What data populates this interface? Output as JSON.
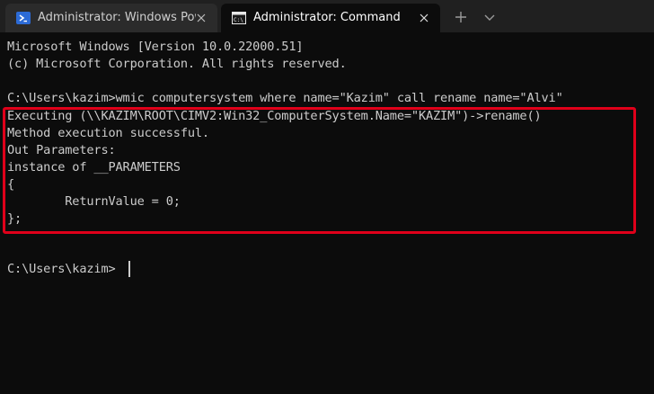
{
  "tabs": [
    {
      "label": "Administrator: Windows PowerShell",
      "icon": "powershell-icon",
      "active": false
    },
    {
      "label": "Administrator: Command Prompt",
      "icon": "cmd-icon",
      "active": true
    }
  ],
  "tabstrip": {
    "new_tab_icon": "plus-icon",
    "dropdown_icon": "chevron-down-icon"
  },
  "terminal": {
    "lines": [
      "Microsoft Windows [Version 10.0.22000.51]",
      "(c) Microsoft Corporation. All rights reserved.",
      "",
      "C:\\Users\\kazim>wmic computersystem where name=\"Kazim\" call rename name=\"Alvi\"",
      "Executing (\\\\KAZIM\\ROOT\\CIMV2:Win32_ComputerSystem.Name=\"KAZIM\")->rename()",
      "Method execution successful.",
      "Out Parameters:",
      "instance of __PARAMETERS",
      "{",
      "        ReturnValue = 0;",
      "};",
      "",
      "",
      "C:\\Users\\kazim>"
    ],
    "highlight_color": "#e0001a",
    "text_color": "#cccccc",
    "background": "#0c0c0c"
  }
}
